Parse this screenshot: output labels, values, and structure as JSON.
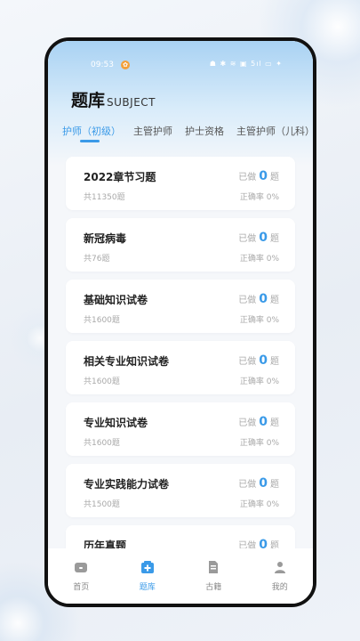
{
  "status_bar": {
    "time": "09:53",
    "notification_badge": "✿",
    "system_icons": "☗ ✱ ≋ ▣ 5ıl ▭ ✦"
  },
  "header": {
    "title": "题库",
    "subtitle": "SUBJECT"
  },
  "tabs": [
    {
      "label": "护师（初级）",
      "active": true
    },
    {
      "label": "主管护师",
      "active": false
    },
    {
      "label": "护士资格",
      "active": false
    },
    {
      "label": "主管护师（儿科）",
      "active": false
    }
  ],
  "cards": [
    {
      "name": "2022章节习题",
      "count": "共11350题",
      "done_prefix": "已做",
      "done_count": "0",
      "done_suffix": "题",
      "accuracy": "正确率 0%"
    },
    {
      "name": "新冠病毒",
      "count": "共76题",
      "done_prefix": "已做",
      "done_count": "0",
      "done_suffix": "题",
      "accuracy": "正确率 0%"
    },
    {
      "name": "基础知识试卷",
      "count": "共1600题",
      "done_prefix": "已做",
      "done_count": "0",
      "done_suffix": "题",
      "accuracy": "正确率 0%"
    },
    {
      "name": "相关专业知识试卷",
      "count": "共1600题",
      "done_prefix": "已做",
      "done_count": "0",
      "done_suffix": "题",
      "accuracy": "正确率 0%"
    },
    {
      "name": "专业知识试卷",
      "count": "共1600题",
      "done_prefix": "已做",
      "done_count": "0",
      "done_suffix": "题",
      "accuracy": "正确率 0%"
    },
    {
      "name": "专业实践能力试卷",
      "count": "共1500题",
      "done_prefix": "已做",
      "done_count": "0",
      "done_suffix": "题",
      "accuracy": "正确率 0%"
    },
    {
      "name": "历年真题",
      "count": "",
      "done_prefix": "已做",
      "done_count": "0",
      "done_suffix": "题",
      "accuracy": ""
    }
  ],
  "tabbar": [
    {
      "label": "首页",
      "icon": "home-icon",
      "active": false
    },
    {
      "label": "题库",
      "icon": "question-bank-icon",
      "active": true
    },
    {
      "label": "古籍",
      "icon": "book-icon",
      "active": false
    },
    {
      "label": "我的",
      "icon": "profile-icon",
      "active": false
    }
  ],
  "colors": {
    "accent": "#3a9ae8",
    "header_top": "#a9d2f3",
    "inactive_icon": "#9a9a9a"
  }
}
